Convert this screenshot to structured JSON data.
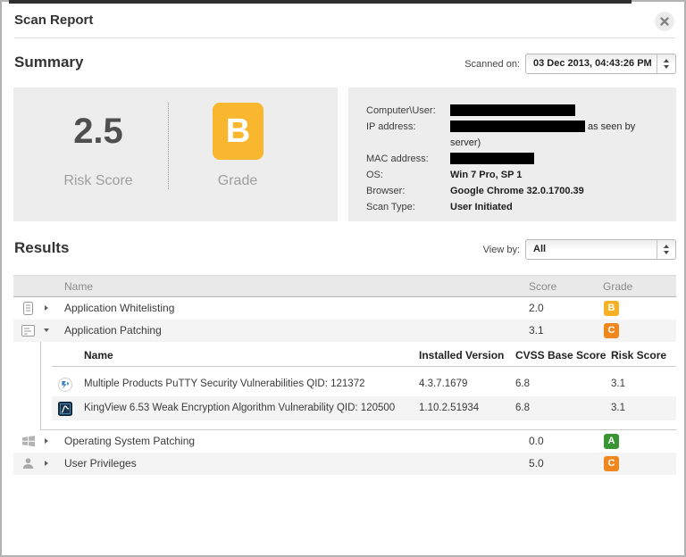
{
  "dialog": {
    "title": "Scan Report",
    "close_label": "×"
  },
  "summary": {
    "heading": "Summary",
    "scanned_on_label": "Scanned on:",
    "scanned_on_value": "03 Dec 2013, 04:43:26 PM",
    "risk_score": "2.5",
    "risk_score_label": "Risk Score",
    "grade": "B",
    "grade_label": "Grade",
    "grade_color": "#f9b62f",
    "details": {
      "computer_label": "Computer\\User:",
      "ip_label": "IP address:",
      "ip_suffix_line1": "as seen by",
      "ip_suffix_line2": "server)",
      "mac_label": "MAC address:",
      "os_label": "OS:",
      "os_value": "Win 7 Pro, SP 1",
      "browser_label": "Browser:",
      "browser_value": "Google Chrome 32.0.1700.39",
      "scan_type_label": "Scan Type:",
      "scan_type_value": "User Initiated"
    }
  },
  "results": {
    "heading": "Results",
    "view_by_label": "View by:",
    "view_by_value": "All",
    "table": {
      "headers": {
        "name": "Name",
        "score": "Score",
        "grade": "Grade"
      },
      "rows": [
        {
          "name": "Application Whitelisting",
          "score": "2.0",
          "grade": "B",
          "grade_color": "#f7af24"
        },
        {
          "name": "Application Patching",
          "score": "3.1",
          "grade": "C",
          "grade_color": "#f0861c"
        },
        {
          "name": "Operating System Patching",
          "score": "0.0",
          "grade": "A",
          "grade_color": "#399434"
        },
        {
          "name": "User Privileges",
          "score": "5.0",
          "grade": "C",
          "grade_color": "#f0861c"
        }
      ],
      "subtable": {
        "headers": {
          "name": "Name",
          "installed_version": "Installed Version",
          "cvss": "CVSS Base Score",
          "risk": "Risk Score"
        },
        "rows": [
          {
            "name": "Multiple Products PuTTY Security Vulnerabilities QID: 121372",
            "installed_version": "4.3.7.1679",
            "cvss": "6.8",
            "risk": "3.1"
          },
          {
            "name": "KingView 6.53 Weak Encryption Algorithm Vulnerability QID: 120500",
            "installed_version": "1.10.2.51934",
            "cvss": "6.8",
            "risk": "3.1"
          }
        ]
      }
    }
  }
}
